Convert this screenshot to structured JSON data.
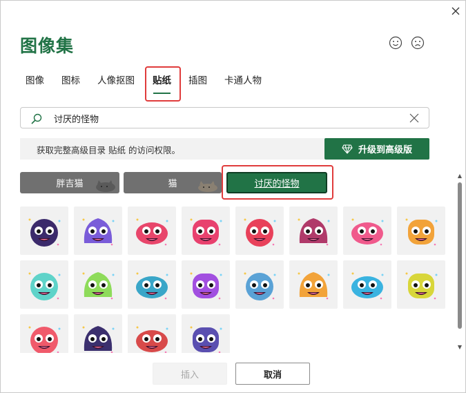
{
  "dialog": {
    "title": "图像集",
    "close_icon": "close-icon",
    "feedback_positive_icon": "smiley-icon",
    "feedback_negative_icon": "frown-icon"
  },
  "tabs": [
    {
      "label": "图像",
      "active": false
    },
    {
      "label": "图标",
      "active": false
    },
    {
      "label": "人像抠图",
      "active": false
    },
    {
      "label": "贴纸",
      "active": true
    },
    {
      "label": "插图",
      "active": false
    },
    {
      "label": "卡通人物",
      "active": false
    }
  ],
  "search": {
    "value": "讨厌的怪物",
    "icon": "search-icon",
    "clear_icon": "clear-icon"
  },
  "banner": {
    "text": "获取完整高级目录 贴纸 的访问权限。",
    "upgrade_label": "升级到高级版",
    "upgrade_icon": "diamond-icon"
  },
  "categories": [
    {
      "label": "胖吉猫",
      "selected": false
    },
    {
      "label": "猫",
      "selected": false
    },
    {
      "label": "讨厌的怪物",
      "selected": true
    }
  ],
  "stickers": [
    {
      "name": "bomb-monster-sticker",
      "color": "#3b2a6b"
    },
    {
      "name": "sleepy-blob-sticker",
      "color": "#7a5cd9"
    },
    {
      "name": "mask-monster-sticker",
      "color": "#e8466b"
    },
    {
      "name": "flower-monster-sticker",
      "color": "#e8416e"
    },
    {
      "name": "heart-monster-sticker",
      "color": "#e8415a"
    },
    {
      "name": "poop-monster-sticker",
      "color": "#b03a6a"
    },
    {
      "name": "ice-cream-monster-sticker",
      "color": "#f05a8c"
    },
    {
      "name": "hand-monster-sticker",
      "color": "#f2a33a"
    },
    {
      "name": "cyan-ghost-sticker",
      "color": "#5fd3c9"
    },
    {
      "name": "green-cactus-monster-sticker",
      "color": "#8edb5a"
    },
    {
      "name": "blue-tongue-monster-sticker",
      "color": "#3aa6c8"
    },
    {
      "name": "jellyfish-monster-sticker",
      "color": "#a24fe0"
    },
    {
      "name": "many-eyes-monster-sticker",
      "color": "#5aa2d6"
    },
    {
      "name": "heart-eyes-blob-sticker",
      "color": "#f2a33a"
    },
    {
      "name": "unicorn-monster-sticker",
      "color": "#3ab3e0"
    },
    {
      "name": "yellow-grumpy-monster-sticker",
      "color": "#d8d63a"
    },
    {
      "name": "pink-screaming-blob-sticker",
      "color": "#f05a6b"
    },
    {
      "name": "dark-cow-monster-sticker",
      "color": "#3b2f6e"
    },
    {
      "name": "red-drooling-monster-sticker",
      "color": "#d84a4a"
    },
    {
      "name": "rainbow-tongue-monster-sticker",
      "color": "#5a4fb0"
    }
  ],
  "footer": {
    "insert_label": "插入",
    "cancel_label": "取消"
  },
  "colors": {
    "accent": "#217346",
    "highlight": "#e03b3b",
    "category_bg": "#707070"
  }
}
